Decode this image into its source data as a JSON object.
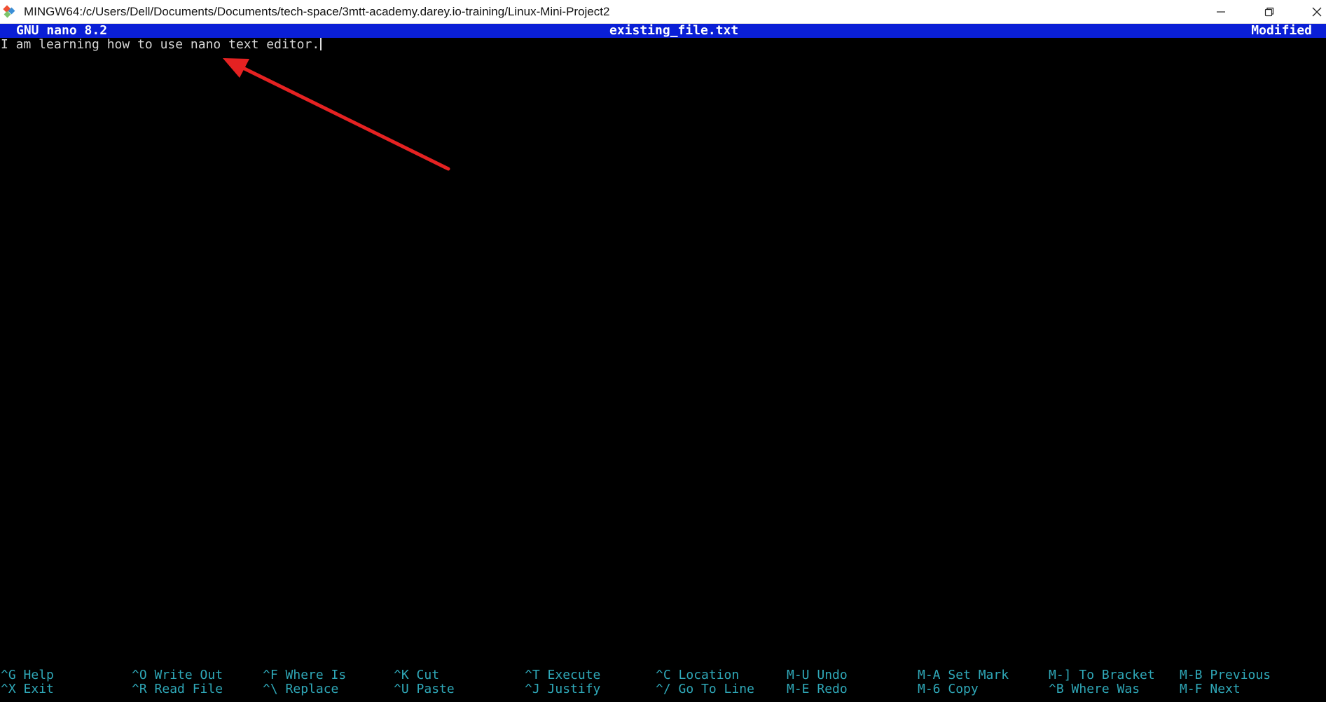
{
  "window": {
    "title": "MINGW64:/c/Users/Dell/Documents/Documents/tech-space/3mtt-academy.darey.io-training/Linux-Mini-Project2",
    "app_icon": "git-bash-icon",
    "controls": [
      "minimize-icon",
      "restore-icon",
      "close-icon"
    ]
  },
  "header": {
    "version": "GNU nano 8.2",
    "filename": "existing_file.txt",
    "status": "Modified"
  },
  "editor": {
    "lines": [
      "I am learning how to use nano text editor."
    ]
  },
  "annotation": {
    "arrow_color": "#e52222",
    "icon": "red-arrow-annotation"
  },
  "colors": {
    "header_bg": "#0a1fd6",
    "shortcut_text": "#2fa8b8",
    "editor_text": "#d6d6d6"
  },
  "shortcuts": {
    "row1": [
      {
        "key": "^G",
        "label": "Help"
      },
      {
        "key": "^O",
        "label": "Write Out"
      },
      {
        "key": "^F",
        "label": "Where Is"
      },
      {
        "key": "^K",
        "label": "Cut"
      },
      {
        "key": "^T",
        "label": "Execute"
      },
      {
        "key": "^C",
        "label": "Location"
      },
      {
        "key": "M-U",
        "label": "Undo"
      },
      {
        "key": "M-A",
        "label": "Set Mark"
      },
      {
        "key": "M-]",
        "label": "To Bracket"
      },
      {
        "key": "M-B",
        "label": "Previous"
      }
    ],
    "row2": [
      {
        "key": "^X",
        "label": "Exit"
      },
      {
        "key": "^R",
        "label": "Read File"
      },
      {
        "key": "^\\",
        "label": "Replace"
      },
      {
        "key": "^U",
        "label": "Paste"
      },
      {
        "key": "^J",
        "label": "Justify"
      },
      {
        "key": "^/",
        "label": "Go To Line"
      },
      {
        "key": "M-E",
        "label": "Redo"
      },
      {
        "key": "M-6",
        "label": "Copy"
      },
      {
        "key": "^B",
        "label": "Where Was"
      },
      {
        "key": "M-F",
        "label": "Next"
      }
    ]
  }
}
